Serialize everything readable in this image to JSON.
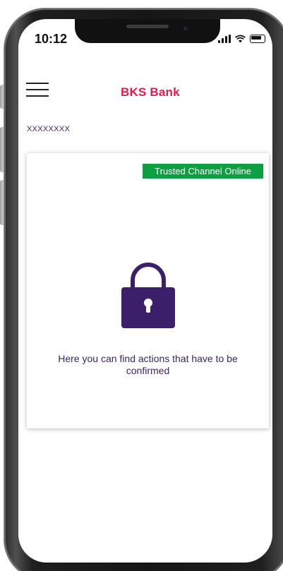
{
  "status_bar": {
    "time": "10:12"
  },
  "header": {
    "menu_icon": "hamburger-menu-icon",
    "logo_text": "BKS Bank",
    "logo_color": "#e6194b"
  },
  "account": {
    "label": "XXXXXXXX"
  },
  "card": {
    "badge_text": "Trusted Channel Online",
    "badge_color": "#0d9f41",
    "icon": "lock-icon",
    "icon_color": "#3b1f6b",
    "message": "Here you can find actions that have to be confirmed"
  }
}
